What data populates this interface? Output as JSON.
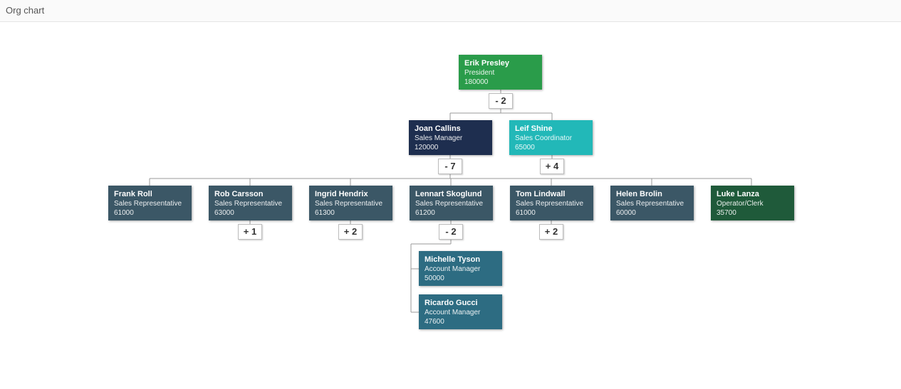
{
  "header": {
    "title": "Org chart"
  },
  "nodes": {
    "erik": {
      "name": "Erik Presley",
      "role": "President",
      "value": "180000"
    },
    "joan": {
      "name": "Joan Callins",
      "role": "Sales Manager",
      "value": "120000"
    },
    "leif": {
      "name": "Leif Shine",
      "role": "Sales Coordinator",
      "value": "65000"
    },
    "frank": {
      "name": "Frank Roll",
      "role": "Sales Representative",
      "value": "61000"
    },
    "rob": {
      "name": "Rob Carsson",
      "role": "Sales Representative",
      "value": "63000"
    },
    "ingrid": {
      "name": "Ingrid Hendrix",
      "role": "Sales Representative",
      "value": "61300"
    },
    "lennart": {
      "name": "Lennart Skoglund",
      "role": "Sales Representative",
      "value": "61200"
    },
    "tom": {
      "name": "Tom Lindwall",
      "role": "Sales Representative",
      "value": "61000"
    },
    "helen": {
      "name": "Helen Brolin",
      "role": "Sales Representative",
      "value": "60000"
    },
    "luke": {
      "name": "Luke Lanza",
      "role": "Operator/Clerk",
      "value": "35700"
    },
    "michelle": {
      "name": "Michelle Tyson",
      "role": "Account Manager",
      "value": "50000"
    },
    "ricardo": {
      "name": "Ricardo Gucci",
      "role": "Account Manager",
      "value": "47600"
    }
  },
  "toggles": {
    "erik": "- 2",
    "joan": "- 7",
    "leif": "+ 4",
    "rob": "+ 1",
    "ingrid": "+ 2",
    "lennart": "- 2",
    "tom": "+ 2"
  },
  "colors": {
    "green": "#2a9c4a",
    "navy": "#1e2e4f",
    "teal": "#22b8b8",
    "slate": "#3b5766",
    "darkgreen": "#1f5a3a",
    "blue": "#2d6c82"
  }
}
